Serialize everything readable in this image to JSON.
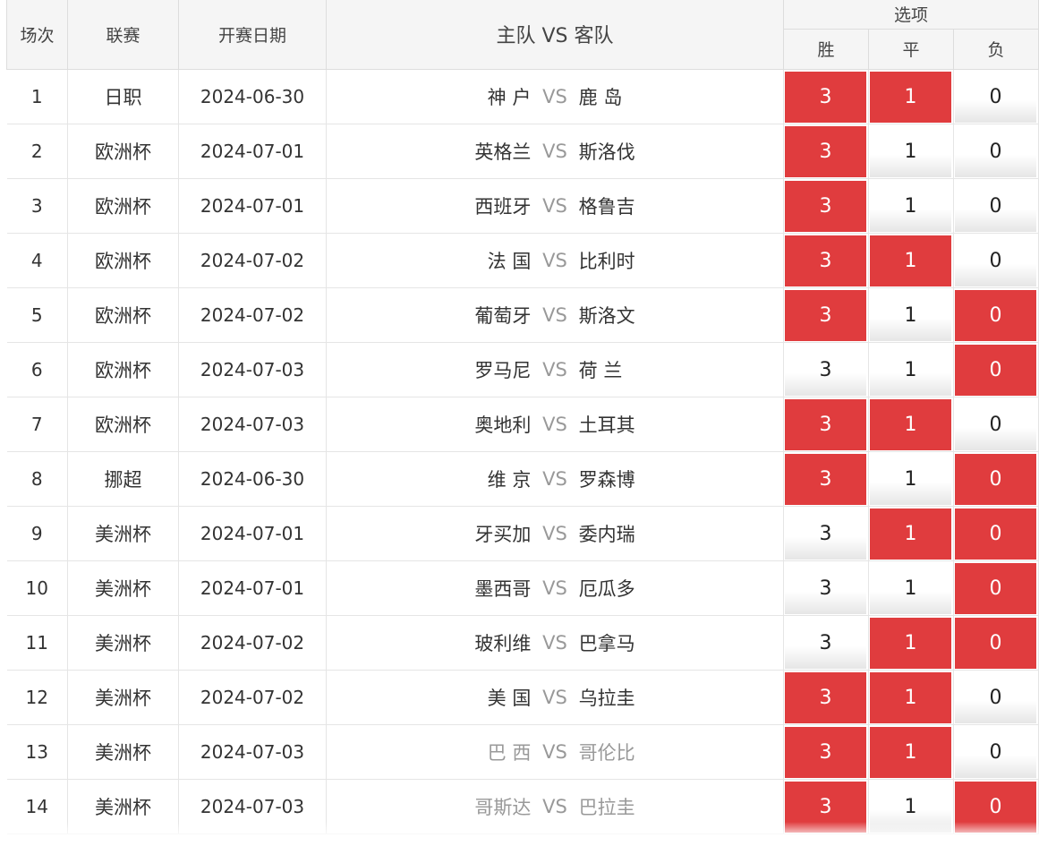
{
  "header": {
    "no": "场次",
    "league": "联赛",
    "date": "开赛日期",
    "match": "主队 VS 客队",
    "options": "选项",
    "win": "胜",
    "draw": "平",
    "lose": "负"
  },
  "colors": {
    "selected": "#e03c3e",
    "header_bg": "#f5f5f5"
  },
  "rows": [
    {
      "no": "1",
      "league": "日职",
      "date": "2024-06-30",
      "home": "神 户",
      "vs": "VS",
      "away": "鹿 岛",
      "win": "3",
      "draw": "1",
      "lose": "0",
      "win_on": true,
      "draw_on": true,
      "lose_on": false,
      "gray": false
    },
    {
      "no": "2",
      "league": "欧洲杯",
      "date": "2024-07-01",
      "home": "英格兰",
      "vs": "VS",
      "away": "斯洛伐",
      "win": "3",
      "draw": "1",
      "lose": "0",
      "win_on": true,
      "draw_on": false,
      "lose_on": false,
      "gray": false
    },
    {
      "no": "3",
      "league": "欧洲杯",
      "date": "2024-07-01",
      "home": "西班牙",
      "vs": "VS",
      "away": "格鲁吉",
      "win": "3",
      "draw": "1",
      "lose": "0",
      "win_on": true,
      "draw_on": false,
      "lose_on": false,
      "gray": false
    },
    {
      "no": "4",
      "league": "欧洲杯",
      "date": "2024-07-02",
      "home": "法 国",
      "vs": "VS",
      "away": "比利时",
      "win": "3",
      "draw": "1",
      "lose": "0",
      "win_on": true,
      "draw_on": true,
      "lose_on": false,
      "gray": false
    },
    {
      "no": "5",
      "league": "欧洲杯",
      "date": "2024-07-02",
      "home": "葡萄牙",
      "vs": "VS",
      "away": "斯洛文",
      "win": "3",
      "draw": "1",
      "lose": "0",
      "win_on": true,
      "draw_on": false,
      "lose_on": true,
      "gray": false
    },
    {
      "no": "6",
      "league": "欧洲杯",
      "date": "2024-07-03",
      "home": "罗马尼",
      "vs": "VS",
      "away": "荷 兰",
      "win": "3",
      "draw": "1",
      "lose": "0",
      "win_on": false,
      "draw_on": false,
      "lose_on": true,
      "gray": false
    },
    {
      "no": "7",
      "league": "欧洲杯",
      "date": "2024-07-03",
      "home": "奥地利",
      "vs": "VS",
      "away": "土耳其",
      "win": "3",
      "draw": "1",
      "lose": "0",
      "win_on": true,
      "draw_on": true,
      "lose_on": false,
      "gray": false
    },
    {
      "no": "8",
      "league": "挪超",
      "date": "2024-06-30",
      "home": "维 京",
      "vs": "VS",
      "away": "罗森博",
      "win": "3",
      "draw": "1",
      "lose": "0",
      "win_on": true,
      "draw_on": false,
      "lose_on": true,
      "gray": false
    },
    {
      "no": "9",
      "league": "美洲杯",
      "date": "2024-07-01",
      "home": "牙买加",
      "vs": "VS",
      "away": "委内瑞",
      "win": "3",
      "draw": "1",
      "lose": "0",
      "win_on": false,
      "draw_on": true,
      "lose_on": true,
      "gray": false
    },
    {
      "no": "10",
      "league": "美洲杯",
      "date": "2024-07-01",
      "home": "墨西哥",
      "vs": "VS",
      "away": "厄瓜多",
      "win": "3",
      "draw": "1",
      "lose": "0",
      "win_on": false,
      "draw_on": false,
      "lose_on": true,
      "gray": false
    },
    {
      "no": "11",
      "league": "美洲杯",
      "date": "2024-07-02",
      "home": "玻利维",
      "vs": "VS",
      "away": "巴拿马",
      "win": "3",
      "draw": "1",
      "lose": "0",
      "win_on": false,
      "draw_on": true,
      "lose_on": true,
      "gray": false
    },
    {
      "no": "12",
      "league": "美洲杯",
      "date": "2024-07-02",
      "home": "美 国",
      "vs": "VS",
      "away": "乌拉圭",
      "win": "3",
      "draw": "1",
      "lose": "0",
      "win_on": true,
      "draw_on": true,
      "lose_on": false,
      "gray": false
    },
    {
      "no": "13",
      "league": "美洲杯",
      "date": "2024-07-03",
      "home": "巴 西",
      "vs": "VS",
      "away": "哥伦比",
      "win": "3",
      "draw": "1",
      "lose": "0",
      "win_on": true,
      "draw_on": true,
      "lose_on": false,
      "gray": true
    },
    {
      "no": "14",
      "league": "美洲杯",
      "date": "2024-07-03",
      "home": "哥斯达",
      "vs": "VS",
      "away": "巴拉圭",
      "win": "3",
      "draw": "1",
      "lose": "0",
      "win_on": true,
      "draw_on": false,
      "lose_on": true,
      "gray": true
    }
  ]
}
